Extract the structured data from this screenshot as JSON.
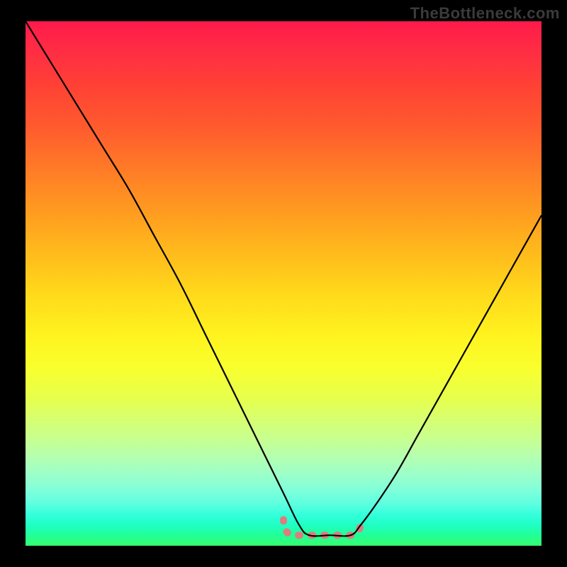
{
  "watermark": {
    "text": "TheBottleneck.com"
  },
  "colors": {
    "background": "#000000",
    "curve": "#000000",
    "valley_marker": "#e07a7d",
    "gradient_top": "#ff1a4a",
    "gradient_bottom": "#35ff6e"
  },
  "chart_data": {
    "type": "line",
    "title": "",
    "xlabel": "",
    "ylabel": "",
    "xlim": [
      0,
      100
    ],
    "ylim": [
      0,
      100
    ],
    "grid": false,
    "series": [
      {
        "name": "bottleneck-curve",
        "x": [
          0,
          5,
          10,
          15,
          20,
          25,
          30,
          35,
          40,
          45,
          50,
          53,
          55,
          59,
          63,
          65,
          68,
          72,
          76,
          80,
          84,
          88,
          92,
          96,
          100
        ],
        "y": [
          100,
          92,
          84,
          76,
          68,
          59,
          50,
          40,
          30,
          20,
          10,
          4,
          2,
          2,
          2,
          4,
          8,
          14,
          21,
          28,
          35,
          42,
          49,
          56,
          63
        ]
      }
    ],
    "valley": {
      "x_start": 50,
      "x_end": 65,
      "y": 2
    },
    "annotations": []
  }
}
